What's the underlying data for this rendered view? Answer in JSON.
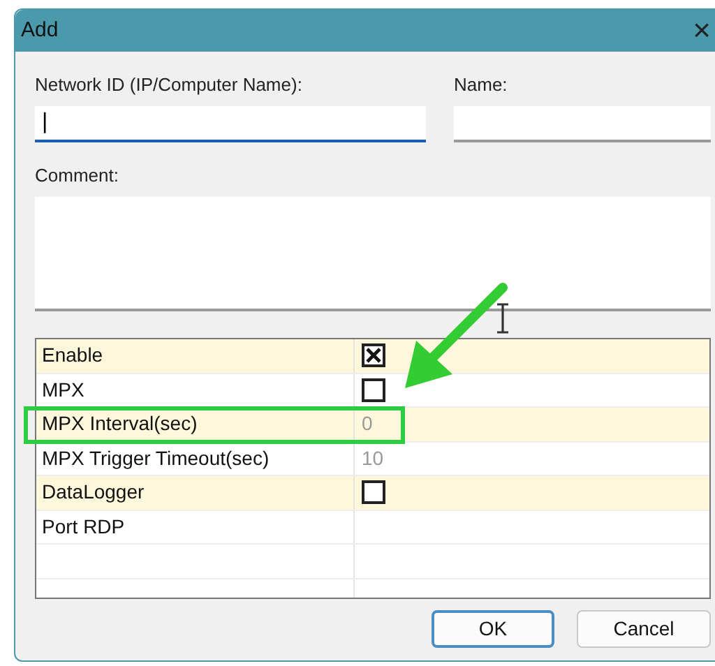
{
  "window": {
    "title": "Add",
    "close": "×"
  },
  "fields": {
    "network_label": "Network ID (IP/Computer Name):",
    "network_value": "|",
    "name_label": "Name:",
    "comment_label": "Comment:"
  },
  "properties": [
    {
      "label": "Enable",
      "kind": "checkbox",
      "checked": true,
      "highlighted": false
    },
    {
      "label": "MPX",
      "kind": "checkbox",
      "checked": false,
      "highlighted": false
    },
    {
      "label": "MPX Interval(sec)",
      "kind": "value",
      "value": "0",
      "highlighted": true
    },
    {
      "label": "MPX Trigger Timeout(sec)",
      "kind": "value",
      "value": "10",
      "highlighted": false
    },
    {
      "label": "DataLogger",
      "kind": "checkbox",
      "checked": false,
      "highlighted": false
    },
    {
      "label": "Port RDP",
      "kind": "value",
      "highlighted": false
    }
  ],
  "buttons": [
    {
      "label": "OK",
      "default": true
    },
    {
      "label": "Cancel",
      "default": false
    }
  ]
}
